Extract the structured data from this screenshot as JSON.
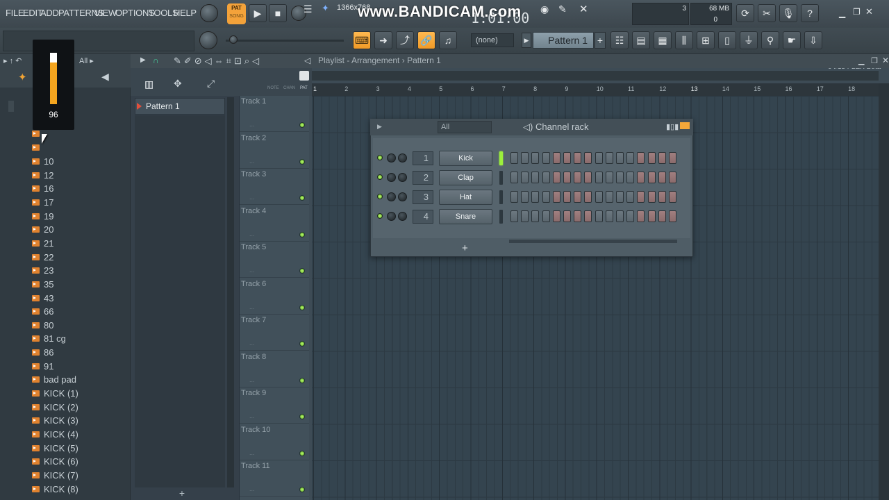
{
  "menu": [
    "FILE",
    "EDIT",
    "ADD",
    "PATTERNS",
    "VIEW",
    "OPTIONS",
    "TOOLS",
    "HELP"
  ],
  "transport": {
    "pat_label": "PAT",
    "song_label": "SONG",
    "resolution": "1366x768",
    "time": "1:01:00"
  },
  "watermark": "www.BANDICAM.com",
  "monitor": {
    "cpu": "3",
    "ram": "68 MB",
    "polyphony": "0"
  },
  "toolbar": {
    "snap": "(none)",
    "pattern": "Pattern 1",
    "plus": "+",
    "news": "04/15  FLEX Beta"
  },
  "browser": {
    "header": "All",
    "volume_value": "96",
    "items": [
      "10",
      "12",
      "16",
      "17",
      "19",
      "20",
      "21",
      "22",
      "23",
      "35",
      "43",
      "66",
      "80",
      "81 cg",
      "86",
      "91",
      "bad pad",
      "KICK (1)",
      "KICK (2)",
      "KICK (3)",
      "KICK (4)",
      "KICK (5)",
      "KICK (6)",
      "KICK (7)",
      "KICK (8)"
    ]
  },
  "playlist": {
    "title": "Playlist - Arrangement",
    "sep": "›",
    "pattern": "Pattern 1",
    "picker_item": "Pattern 1",
    "picker_add": "+",
    "header_labels": [
      "NOTE",
      "CHAN",
      "PAT"
    ],
    "bars": [
      "1",
      "2",
      "3",
      "4",
      "5",
      "6",
      "7",
      "8",
      "9",
      "10",
      "11",
      "12",
      "13",
      "14",
      "15",
      "16",
      "17",
      "18"
    ],
    "tracks": [
      "Track 1",
      "Track 2",
      "Track 3",
      "Track 4",
      "Track 5",
      "Track 6",
      "Track 7",
      "Track 8",
      "Track 9",
      "Track 10",
      "Track 11"
    ],
    "track_dots": "..."
  },
  "channel_rack": {
    "title": "Channel rack",
    "filter": "All",
    "add": "+",
    "channels": [
      {
        "num": "1",
        "name": "Kick",
        "selected": true
      },
      {
        "num": "2",
        "name": "Clap",
        "selected": false
      },
      {
        "num": "3",
        "name": "Hat",
        "selected": false
      },
      {
        "num": "4",
        "name": "Snare",
        "selected": false
      }
    ],
    "step_pattern": [
      "g",
      "g",
      "g",
      "g",
      "r",
      "r",
      "r",
      "r",
      "g",
      "g",
      "g",
      "g",
      "r",
      "r",
      "r",
      "r"
    ]
  },
  "colors": {
    "accent": "#f3a23a",
    "led_green": "#9cf03c",
    "bg": "#3d4b55"
  }
}
